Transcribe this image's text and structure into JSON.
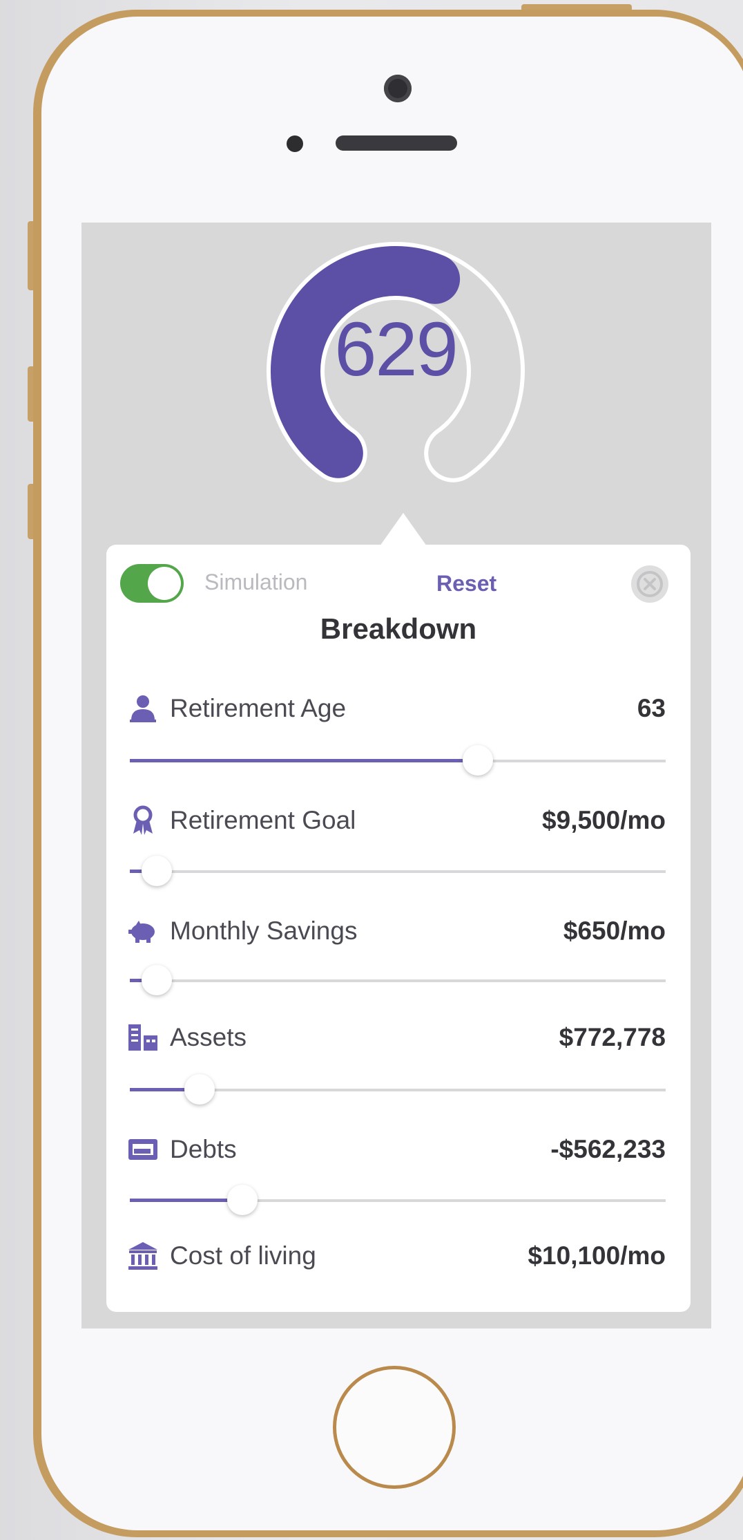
{
  "gauge": {
    "score": "629",
    "fill_fraction": 0.58,
    "accent_color": "#5c4fa6",
    "track_color": "#d8d8d9"
  },
  "toolbar": {
    "simulation_label": "Simulation",
    "simulation_enabled": true,
    "reset_label": "Reset",
    "close_icon": "close-icon"
  },
  "card": {
    "title": "Breakdown"
  },
  "rows": [
    {
      "label": "Retirement Age",
      "value": "63",
      "icon": "person-icon",
      "slider_fraction": 0.65
    },
    {
      "label": "Retirement Goal",
      "value": "$9,500/mo",
      "icon": "award-ribbon-icon",
      "slider_fraction": 0.05
    },
    {
      "label": "Monthly Savings",
      "value": "$650/mo",
      "icon": "piggy-bank-icon",
      "slider_fraction": 0.05
    },
    {
      "label": "Assets",
      "value": "$772,778",
      "icon": "buildings-icon",
      "slider_fraction": 0.13
    },
    {
      "label": "Debts",
      "value": "-$562,233",
      "icon": "credit-card-icon",
      "slider_fraction": 0.21
    },
    {
      "label": "Cost of living",
      "value": "$10,100/mo",
      "icon": "bank-icon",
      "slider_fraction": null
    }
  ],
  "colors": {
    "accent": "#6a5fb3",
    "toggle_on": "#53a64a",
    "phone_frame": "#c59c5f"
  }
}
